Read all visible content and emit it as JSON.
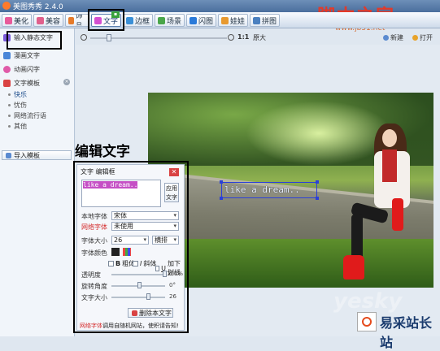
{
  "window": {
    "title": "美图秀秀 2.4.0"
  },
  "brand": {
    "name": "脚本之家",
    "url": "www.jb51.net"
  },
  "tabs": [
    {
      "label": "美化",
      "color": "#e85a9a"
    },
    {
      "label": "美容",
      "color": "#e0608c"
    },
    {
      "label": "饰品",
      "color": "#e57a2a"
    },
    {
      "label": "文字",
      "color": "#d44fd0"
    },
    {
      "label": "边框",
      "color": "#3a8fd6"
    },
    {
      "label": "场景",
      "color": "#4aa64a"
    },
    {
      "label": "闪图",
      "color": "#2a7ad9"
    },
    {
      "label": "娃娃",
      "color": "#e89a30"
    },
    {
      "label": "拼图",
      "color": "#4a80c0"
    }
  ],
  "sidebar": {
    "input_static": "输入静态文字",
    "comic_text": "漫画文字",
    "animated_text": "动画闪字",
    "template_header": "文字模板",
    "template_items": [
      "快乐",
      "忧伤",
      "网络流行语",
      "其他"
    ],
    "close_glyph": "×",
    "import_label": "导入模板"
  },
  "toolbar": {
    "zoom_ratio": "1:1",
    "zoom_label": "原大",
    "new_label": "新建",
    "open_label": "打开"
  },
  "canvas": {
    "overlay_text": "like a dream.."
  },
  "annotation": "编辑文字",
  "panel": {
    "title": "文字 编辑框",
    "close_glyph": "✕",
    "text_value": "like a dream..",
    "apply_label": "应用文字",
    "local_font_label": "本地字体",
    "local_font_value": "宋体",
    "web_font_label": "网络字体",
    "web_font_value": "未使用",
    "size_label": "字体大小",
    "size_value": "26",
    "orientation_value": "横排",
    "color_label": "字体颜色",
    "bold_label": "粗体",
    "italic_label": "斜体",
    "underline_label": "加下划线",
    "opacity_label": "透明度",
    "opacity_value": "100%",
    "rotation_label": "旋转角度",
    "rotation_value": "0°",
    "textsize_label": "文字大小",
    "textsize_value": "26",
    "delete_label": "删除本文字",
    "footnote_red": "网络字体",
    "footnote_rest": "调用自随机网站，使积请告知!"
  },
  "watermark": {
    "site": "易采站长站",
    "yesky": "yesky"
  },
  "progress": {
    "zoom_fraction": 0.12,
    "opacity": 1.0,
    "rotation": 0.5,
    "textsize": 0.68
  }
}
